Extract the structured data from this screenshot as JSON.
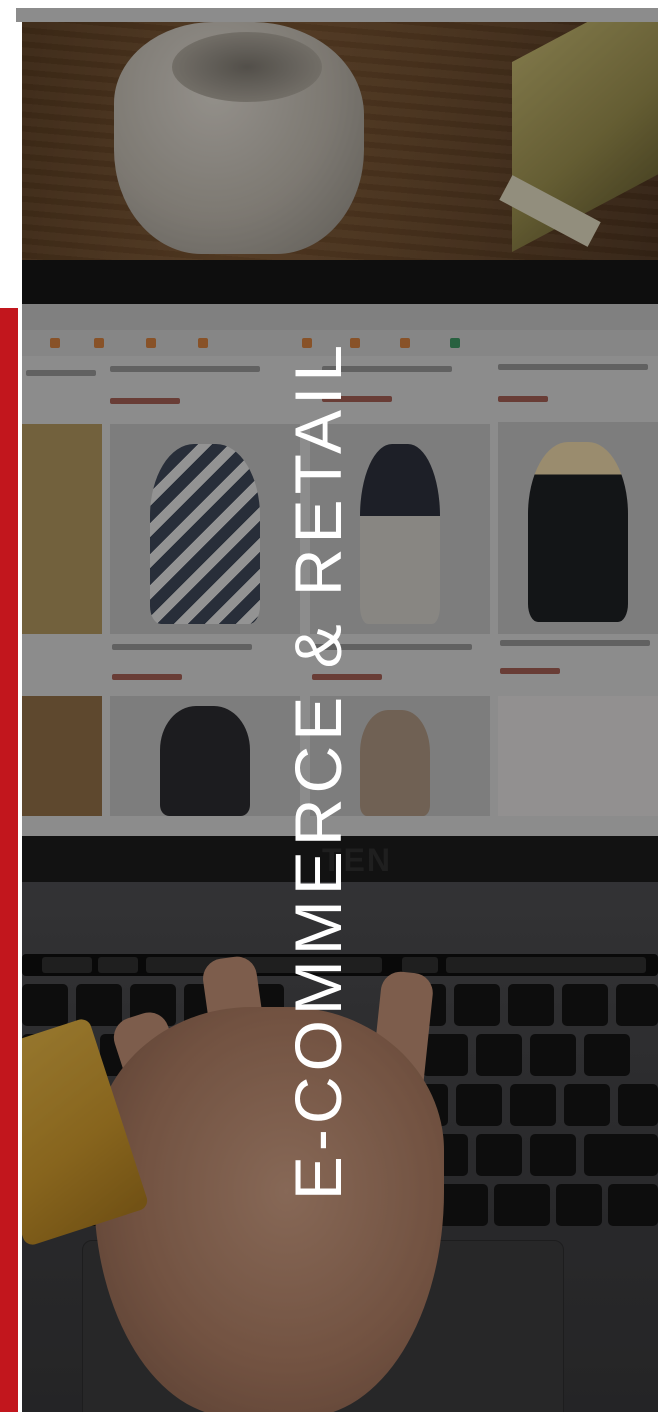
{
  "banner": {
    "title": "E-COMMERCE & RETAIL",
    "accent_color": "#c2161d",
    "text_color": "#ffffff"
  },
  "photo": {
    "screen_logo": "TEN"
  }
}
